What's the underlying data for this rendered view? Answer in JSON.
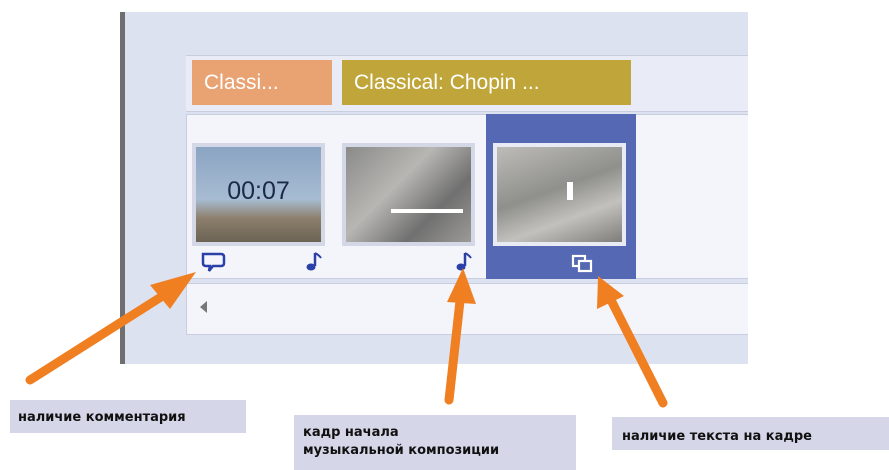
{
  "tabs": [
    {
      "label": "Classi...",
      "color": "#e9a272"
    },
    {
      "label": "Classical: Chopin ...",
      "color": "#c0a63a"
    }
  ],
  "thumbnails": [
    {
      "overlay_text": "00:07",
      "icons": [
        "comment-icon",
        "music-note-icon"
      ]
    },
    {
      "icons": [
        "music-note-icon"
      ]
    },
    {
      "selected": true,
      "icons": [
        "text-overlay-icon"
      ]
    }
  ],
  "annotations": {
    "comment": "наличие комментария",
    "music_start_line1": "кадр начала",
    "music_start_line2": "музыкальной композиции",
    "text_on_frame": "наличие текста на кадре"
  },
  "colors": {
    "arrow": "#f07f22",
    "selection": "#5568b4",
    "icon": "#2a3fa8"
  }
}
